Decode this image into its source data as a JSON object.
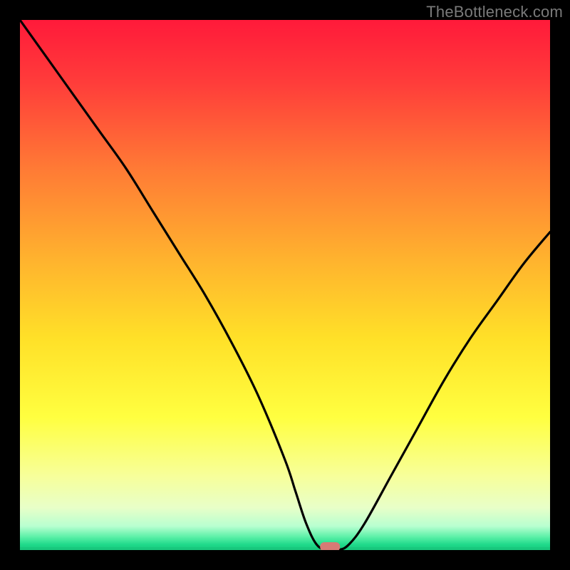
{
  "attribution": "TheBottleneck.com",
  "chart_data": {
    "type": "line",
    "title": "",
    "xlabel": "",
    "ylabel": "",
    "xlim": [
      0,
      100
    ],
    "ylim": [
      0,
      100
    ],
    "grid": false,
    "x": [
      0,
      5,
      10,
      15,
      20,
      25,
      30,
      35,
      40,
      45,
      50,
      52,
      54,
      56,
      58,
      60,
      62,
      65,
      70,
      75,
      80,
      85,
      90,
      95,
      100
    ],
    "values": [
      100,
      93,
      86,
      79,
      72,
      64,
      56,
      48,
      39,
      29,
      17,
      11,
      5,
      1,
      0,
      0,
      1,
      5,
      14,
      23,
      32,
      40,
      47,
      54,
      60
    ],
    "marker": {
      "x": 58.5,
      "y": 0.4,
      "color": "#d77a75"
    },
    "gradient_stops": [
      {
        "offset": 0.0,
        "color": "#ff1a3a"
      },
      {
        "offset": 0.12,
        "color": "#ff3d3a"
      },
      {
        "offset": 0.28,
        "color": "#ff7a35"
      },
      {
        "offset": 0.45,
        "color": "#ffb22e"
      },
      {
        "offset": 0.6,
        "color": "#ffe028"
      },
      {
        "offset": 0.75,
        "color": "#ffff40"
      },
      {
        "offset": 0.86,
        "color": "#f7ff9a"
      },
      {
        "offset": 0.92,
        "color": "#e8ffc8"
      },
      {
        "offset": 0.955,
        "color": "#b8ffd0"
      },
      {
        "offset": 0.975,
        "color": "#5cf0a8"
      },
      {
        "offset": 0.99,
        "color": "#1fd98a"
      },
      {
        "offset": 1.0,
        "color": "#18c87d"
      }
    ]
  }
}
